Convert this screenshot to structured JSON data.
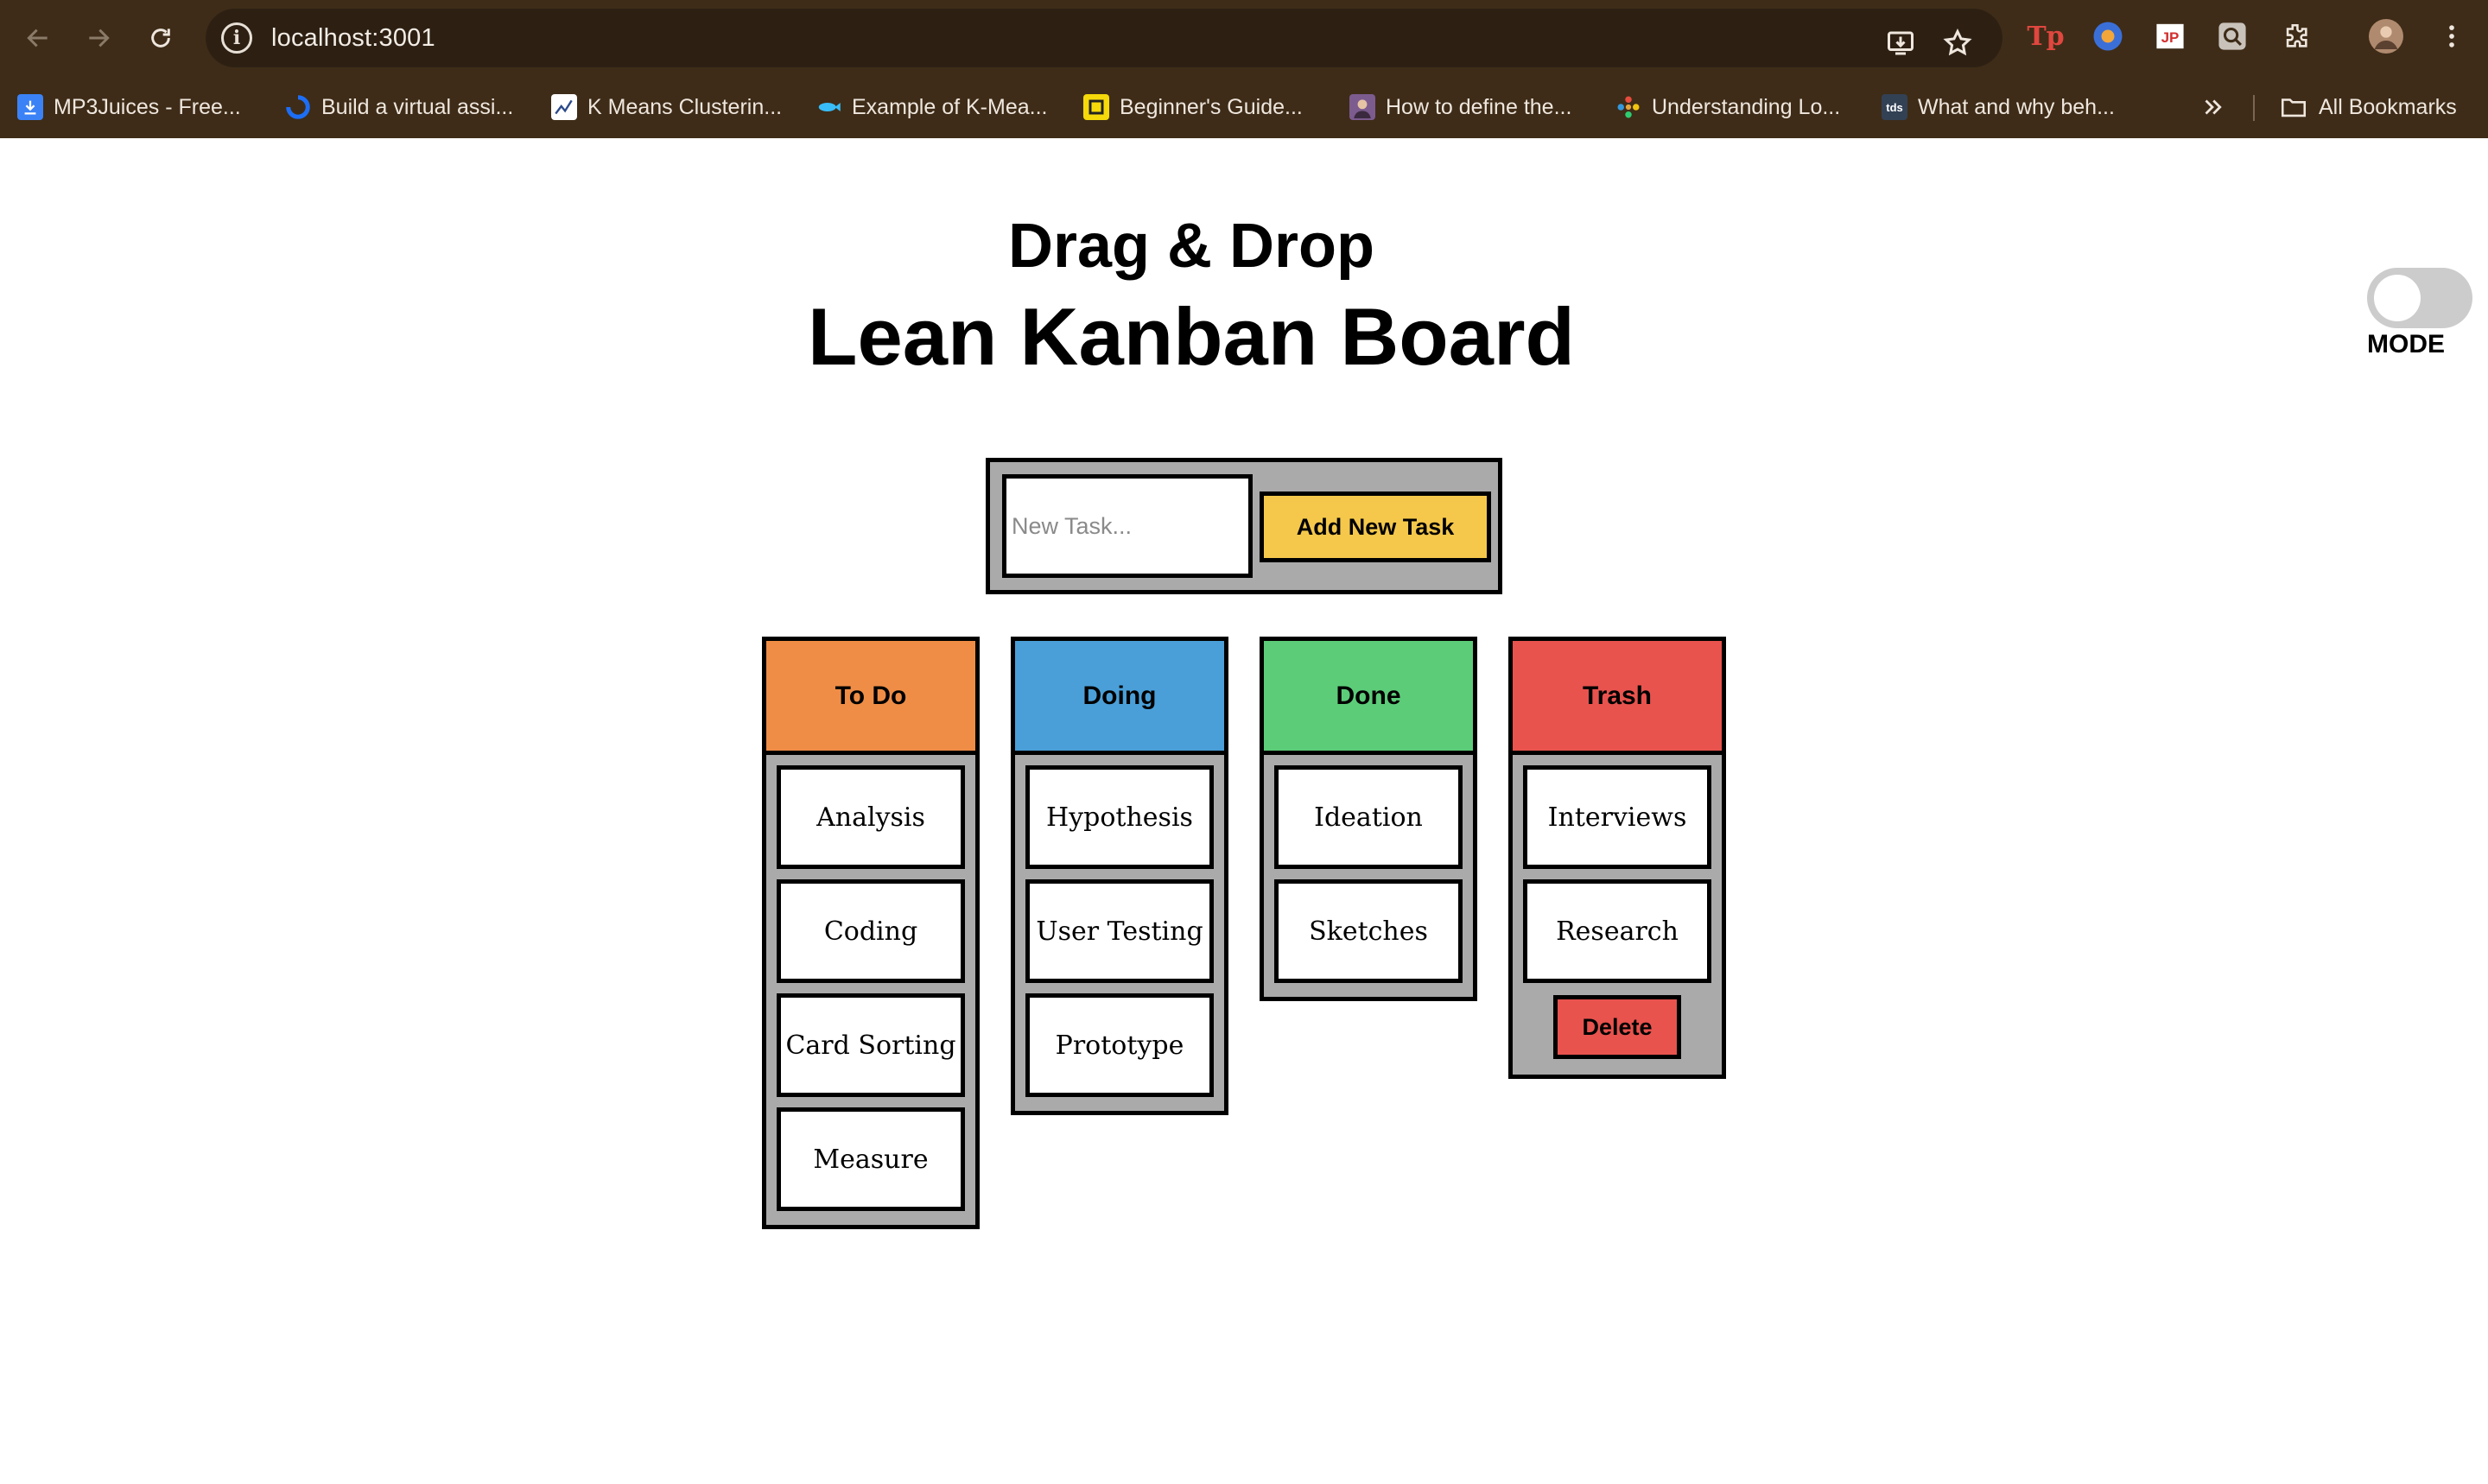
{
  "browser": {
    "url": "localhost:3001",
    "bookmarks": [
      {
        "label": "MP3Juices - Free...",
        "icon": "download-icon",
        "color": "#3b82f6"
      },
      {
        "label": "Build a virtual assi...",
        "icon": "digitalocean-icon",
        "color": "#1d6ef5"
      },
      {
        "label": "K Means Clusterin...",
        "icon": "chart-icon",
        "color": "#ffffff"
      },
      {
        "label": "Example of K-Mea...",
        "icon": "fish-icon",
        "color": "#38bdf8"
      },
      {
        "label": "Beginner's Guide...",
        "icon": "square-logo-icon",
        "color": "#f5d90a"
      },
      {
        "label": "How to define the...",
        "icon": "avatar-icon",
        "color": "#7c5b8f"
      },
      {
        "label": "Understanding Lo...",
        "icon": "flower-icon",
        "color": "#e5a53b"
      },
      {
        "label": "What and why beh...",
        "icon": "tds-icon",
        "color": "#334155",
        "text": "tds"
      }
    ],
    "all_bookmarks_label": "All Bookmarks"
  },
  "header": {
    "subtitle": "Drag & Drop",
    "title": "Lean Kanban Board",
    "mode_label": "MODE"
  },
  "new_task": {
    "placeholder": "New Task...",
    "button_label": "Add New Task"
  },
  "columns": [
    {
      "title": "To Do",
      "color": "#ef8d46",
      "cards": [
        "Analysis",
        "Coding",
        "Card Sorting",
        "Measure"
      ]
    },
    {
      "title": "Doing",
      "color": "#4a9fd8",
      "cards": [
        "Hypothesis",
        "User Testing",
        "Prototype"
      ]
    },
    {
      "title": "Done",
      "color": "#5ccc79",
      "cards": [
        "Ideation",
        "Sketches"
      ]
    },
    {
      "title": "Trash",
      "color": "#e8534e",
      "cards": [
        "Interviews",
        "Research"
      ],
      "action": "Delete"
    }
  ],
  "colors": {
    "chrome": "#3e2c18",
    "panel": "#aaaaaa",
    "add_button": "#f5c84b"
  }
}
